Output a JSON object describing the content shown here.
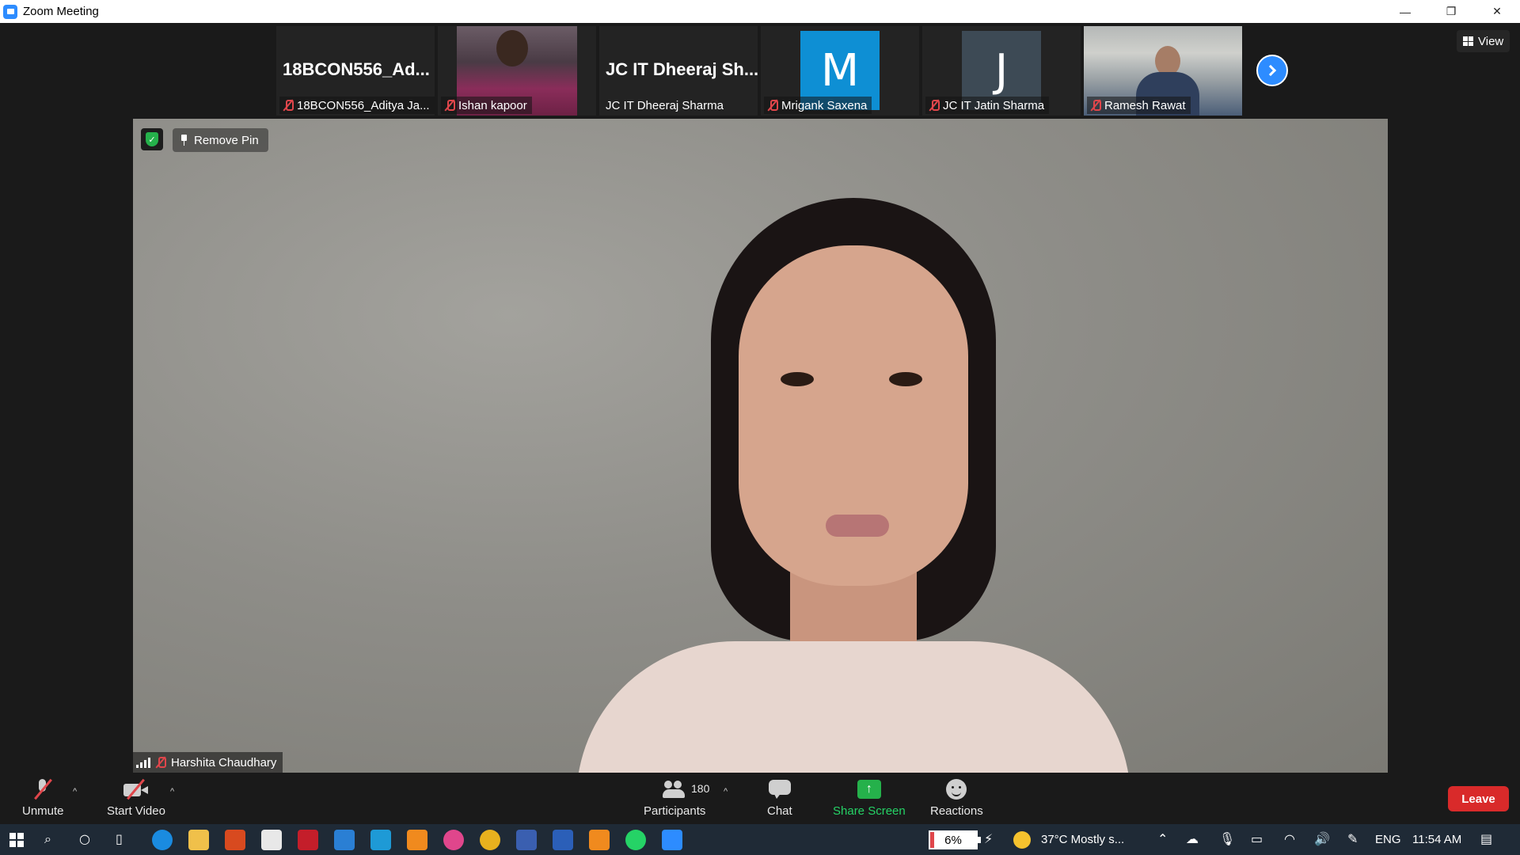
{
  "window": {
    "title": "Zoom Meeting",
    "minimize": "—",
    "maximize": "❐",
    "close": "✕"
  },
  "thumbnails": [
    {
      "big_name": "18BCON556_Ad...",
      "label": "18BCON556_Aditya Ja..."
    },
    {
      "big_name": "",
      "label": "Ishan kapoor"
    },
    {
      "big_name": "JC IT Dheeraj Sh...",
      "label": "JC IT Dheeraj Sharma"
    },
    {
      "avatar_letter": "M",
      "label": "Mrigank Saxena"
    },
    {
      "avatar_letter": "J",
      "label": "JC IT Jatin Sharma"
    },
    {
      "big_name": "",
      "label": "Ramesh Rawat"
    }
  ],
  "view_button": "View",
  "main": {
    "remove_pin": "Remove Pin",
    "speaker_name": "Harshita Chaudhary"
  },
  "toolbar": {
    "unmute": "Unmute",
    "start_video": "Start Video",
    "participants": "Participants",
    "participant_count": "180",
    "chat": "Chat",
    "share_screen": "Share Screen",
    "reactions": "Reactions",
    "leave": "Leave",
    "caret": "^"
  },
  "taskbar": {
    "battery": "6%",
    "weather": "37°C  Mostly s...",
    "language": "ENG",
    "time": "11:54 AM"
  },
  "colors": {
    "zoom_blue": "#2d8cff",
    "leave_red": "#d92a2a",
    "share_green": "#25b14b",
    "avatar_m": "#0e8fd4",
    "avatar_j": "#3d4a55"
  }
}
